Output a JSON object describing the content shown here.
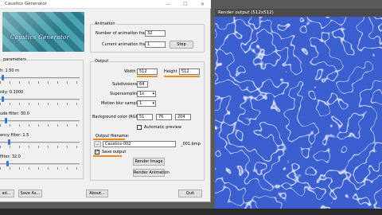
{
  "window": {
    "title": "Caustics Generator",
    "minimize": "—",
    "maximize": "☐",
    "close": "✕"
  },
  "logo": {
    "text": "Caustics Generator"
  },
  "parameters": {
    "group_label": "parameters",
    "sliders": [
      {
        "label": "h: 1.50 m",
        "level": 0.02
      },
      {
        "label": "sity: 0.1000",
        "level": 0.02
      },
      {
        "label": "ude filter: 30.0",
        "level": 0.06
      },
      {
        "label": "ency filter: 1.5",
        "level": 0.1
      },
      {
        "label": "filter: 32.0",
        "level": 0.08
      }
    ]
  },
  "animation": {
    "group_label": "Animation",
    "frames_label": "Number of animation frames",
    "frames_value": "32",
    "current_label": "Current animation frame",
    "current_value": "1",
    "step_label": "Step"
  },
  "output": {
    "group_label": "Output",
    "width_label": "Width",
    "width_value": "512",
    "height_label": "Height",
    "height_value": "512",
    "subdiv_label": "Subdivisions",
    "subdiv_value": "64",
    "supersampling_label": "Supersampling",
    "supersampling_value": "1x",
    "motion_blur_label": "Motion blur samples",
    "motion_blur_value": "1",
    "bgcolor_label": "Background color (RGB)",
    "bg_r": "51",
    "bg_g": "76",
    "bg_b": "204",
    "auto_preview_label": "Automatic preview",
    "filename_label": "Output filename:",
    "filename_value": "Caustics-002",
    "filename_suffix": "_001.bmp",
    "browse_label": "...",
    "save_output_label": "Save output",
    "save_output_checked": "✓",
    "render_image_label": "Render Image",
    "render_animation_label": "Render Animation"
  },
  "bottom": {
    "load_label": "ad...",
    "save_as_label": "Save As...",
    "about_label": "About...",
    "quit_label": "Quit"
  },
  "render_window": {
    "title": "Render output (512x512)"
  },
  "colors": {
    "accent_underline": "#f08a1c",
    "slider_thumb": "#2c7bd6",
    "render_bg": "#3b5fcf"
  }
}
